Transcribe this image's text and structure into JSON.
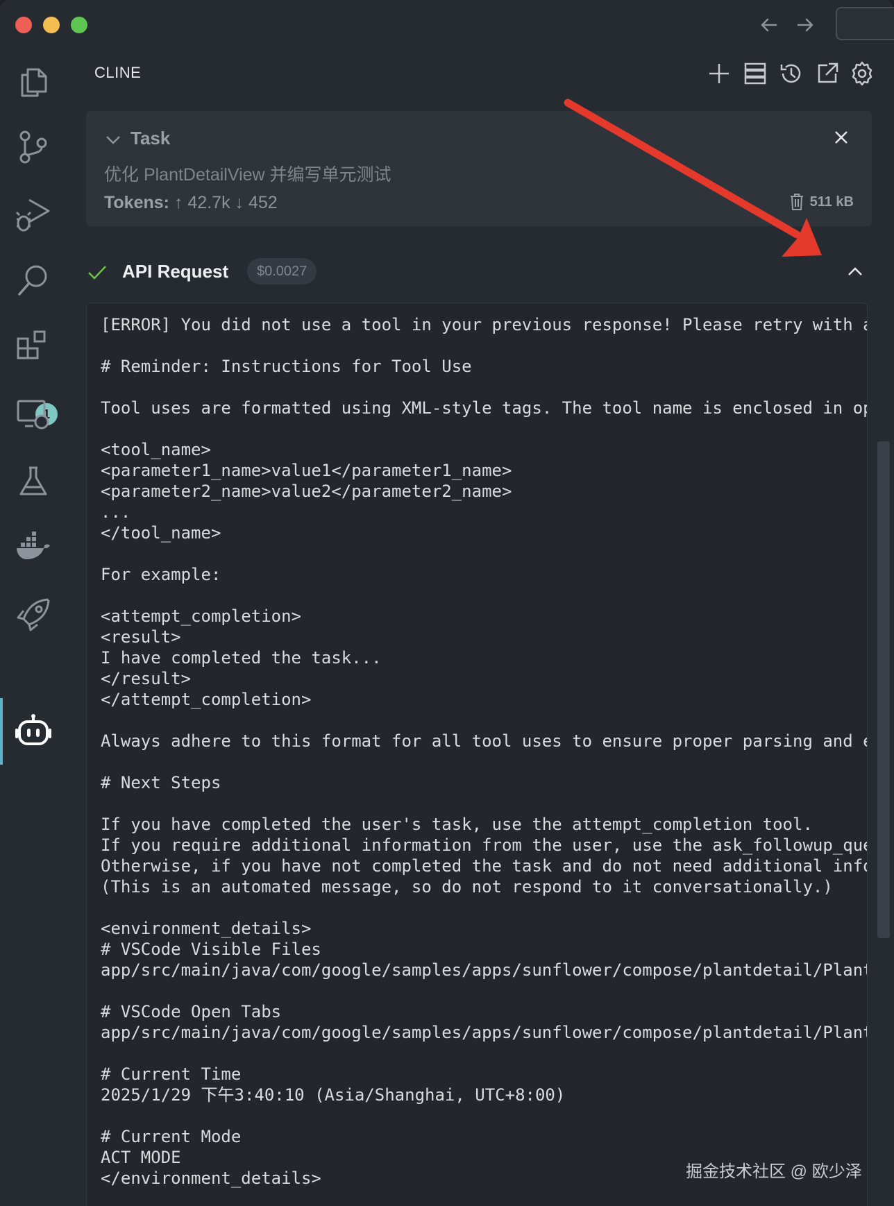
{
  "header": {
    "title": "CLINE"
  },
  "task": {
    "title": "Task",
    "description": "优化 PlantDetailView 并编写单元测试",
    "tokens_label": "Tokens:",
    "tokens_up": "42.7k",
    "tokens_down": "452",
    "size": "511 kB"
  },
  "api_request": {
    "title": "API Request",
    "cost": "$0.0027"
  },
  "activity_badge": "1",
  "code_lines": [
    "[ERROR] You did not use a tool in your previous response! Please retry with a",
    "",
    "# Reminder: Instructions for Tool Use",
    "",
    "Tool uses are formatted using XML-style tags. The tool name is enclosed in op",
    "",
    "<tool_name>",
    "<parameter1_name>value1</parameter1_name>",
    "<parameter2_name>value2</parameter2_name>",
    "...",
    "</tool_name>",
    "",
    "For example:",
    "",
    "<attempt_completion>",
    "<result>",
    "I have completed the task...",
    "</result>",
    "</attempt_completion>",
    "",
    "Always adhere to this format for all tool uses to ensure proper parsing and e",
    "",
    "# Next Steps",
    "",
    "If you have completed the user's task, use the attempt_completion tool.",
    "If you require additional information from the user, use the ask_followup_que",
    "Otherwise, if you have not completed the task and do not need additional info",
    "(This is an automated message, so do not respond to it conversationally.)",
    "",
    "<environment_details>",
    "# VSCode Visible Files",
    "app/src/main/java/com/google/samples/apps/sunflower/compose/plantdetail/Plant",
    "",
    "# VSCode Open Tabs",
    "app/src/main/java/com/google/samples/apps/sunflower/compose/plantdetail/Plant",
    "",
    "# Current Time",
    "2025/1/29 下午3:40:10 (Asia/Shanghai, UTC+8:00)",
    "",
    "# Current Mode",
    "ACT MODE",
    "</environment_details>"
  ],
  "watermark": "掘金技术社区 @ 欧少泽",
  "colors": {
    "background": "#262a31",
    "task_card": "#2f343b",
    "accent_teal": "#5bb2c9",
    "check_green": "#6fc24a",
    "arrow_red": "#e5392b"
  },
  "icons": {
    "activity": [
      "files-icon",
      "source-control-icon",
      "run-debug-icon",
      "search-icon",
      "extensions-icon",
      "remote-explorer-icon",
      "testing-icon",
      "docker-icon",
      "rocket-icon",
      "cline-robot-icon"
    ],
    "panel_actions": [
      "plus-icon",
      "server-icon",
      "history-icon",
      "popout-icon",
      "gear-icon"
    ]
  }
}
